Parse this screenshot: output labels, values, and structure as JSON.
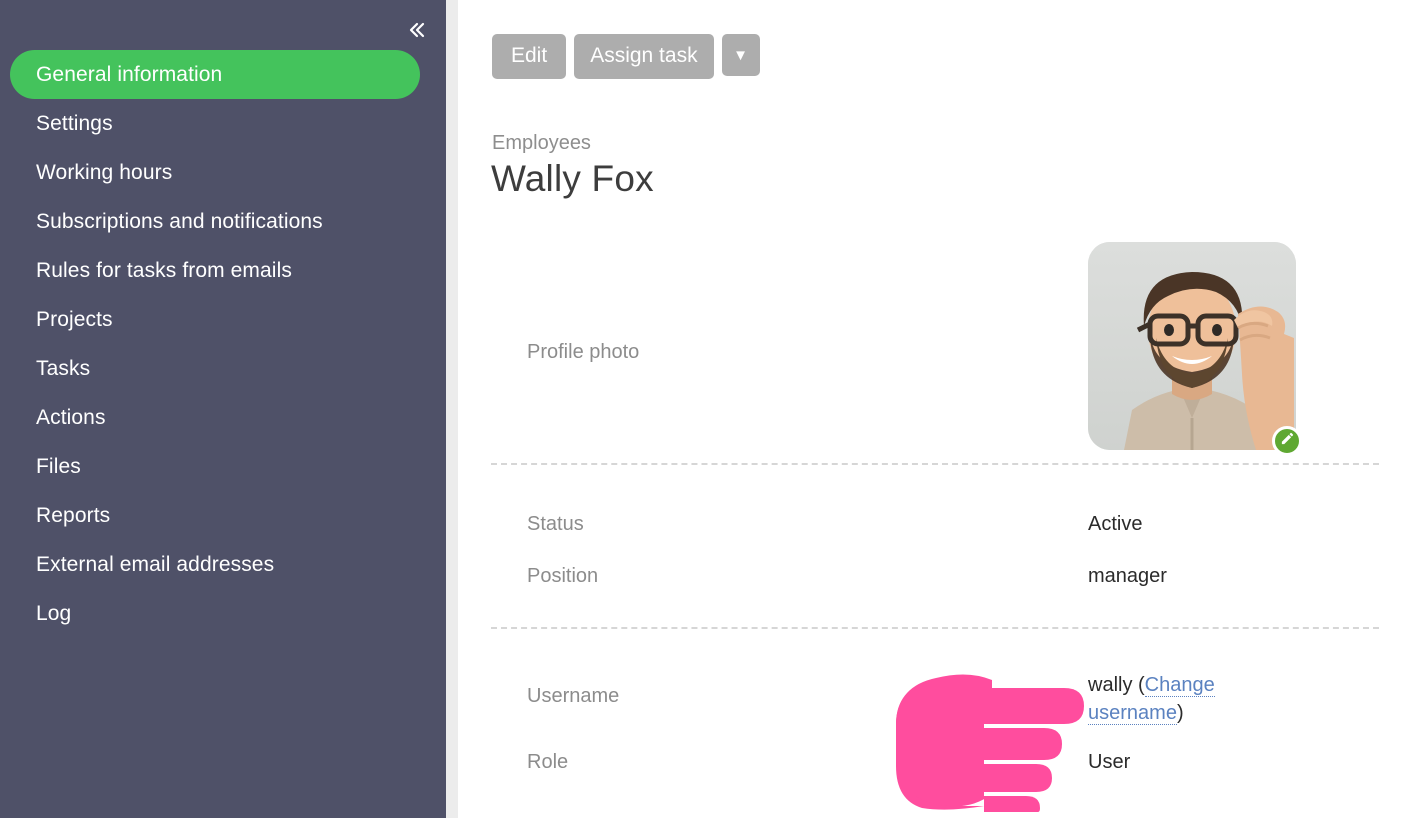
{
  "theme": {
    "sidebar_bg": "#4f5168",
    "accent_green": "#44c35c",
    "button_gray": "#adadad",
    "link_blue": "#5b82c0",
    "label_gray": "#8c8c8c",
    "value_dark": "#2b2b2b",
    "pointer_pink": "#ff4d9e",
    "badge_green": "#5fa832"
  },
  "sidebar": {
    "collapse_icon": "chevron-double-left-icon",
    "items": [
      {
        "label": "General information",
        "active": true
      },
      {
        "label": "Settings",
        "active": false
      },
      {
        "label": "Working hours",
        "active": false
      },
      {
        "label": "Subscriptions and notifications",
        "active": false
      },
      {
        "label": "Rules for tasks from emails",
        "active": false
      },
      {
        "label": "Projects",
        "active": false
      },
      {
        "label": "Tasks",
        "active": false
      },
      {
        "label": "Actions",
        "active": false
      },
      {
        "label": "Files",
        "active": false
      },
      {
        "label": "Reports",
        "active": false
      },
      {
        "label": "External email addresses",
        "active": false
      },
      {
        "label": "Log",
        "active": false
      }
    ]
  },
  "toolbar": {
    "edit_label": "Edit",
    "assign_task_label": "Assign task",
    "caret_label": "▼",
    "caret_icon": "chevron-down-icon"
  },
  "header": {
    "breadcrumb": "Employees",
    "title": "Wally Fox"
  },
  "fields": {
    "profile_photo_label": "Profile photo",
    "avatar_alt": "avatar-photo",
    "avatar_edit_icon": "pencil-icon",
    "status_label": "Status",
    "status_value": "Active",
    "position_label": "Position",
    "position_value": "manager",
    "username_label": "Username",
    "username_value": "wally",
    "username_open_paren": " (",
    "username_change_link": "Change username",
    "username_close_paren": ")",
    "role_label": "Role",
    "role_value": "User"
  },
  "overlay": {
    "pointer_icon": "pointing-hand-right-icon"
  }
}
